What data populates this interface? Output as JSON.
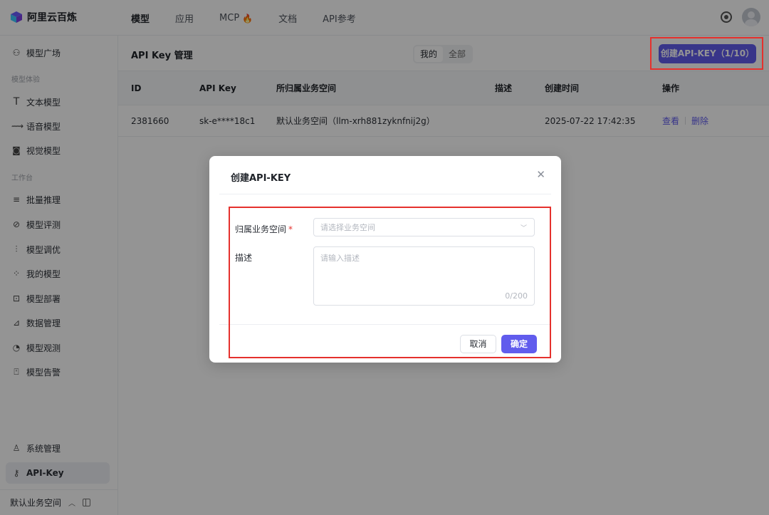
{
  "app": {
    "title": "阿里云百炼"
  },
  "topnav": {
    "items": [
      {
        "label": "模型",
        "active": true
      },
      {
        "label": "应用"
      },
      {
        "label": "MCP",
        "badge_icon": "flame-icon"
      },
      {
        "label": "文档"
      },
      {
        "label": "API参考"
      }
    ]
  },
  "sidebar": {
    "top_item": {
      "label": "模型广场",
      "icon": "model-square-icon"
    },
    "group_experience": "模型体验",
    "experience_items": [
      {
        "label": "文本模型",
        "icon": "text-icon"
      },
      {
        "label": "语音模型",
        "icon": "voice-icon"
      },
      {
        "label": "视觉模型",
        "icon": "camera-icon"
      }
    ],
    "group_workbench": "工作台",
    "workbench_items": [
      {
        "label": "批量推理",
        "icon": "batch-icon"
      },
      {
        "label": "模型评测",
        "icon": "evaluate-icon"
      },
      {
        "label": "模型调优",
        "icon": "tune-icon"
      },
      {
        "label": "我的模型",
        "icon": "grid-icon"
      },
      {
        "label": "模型部署",
        "icon": "deploy-icon"
      },
      {
        "label": "数据管理",
        "icon": "chart-icon"
      },
      {
        "label": "模型观测",
        "icon": "pie-icon"
      },
      {
        "label": "模型告警",
        "icon": "alert-icon"
      }
    ],
    "bottom_items": [
      {
        "label": "系统管理",
        "icon": "user-icon"
      },
      {
        "label": "API-Key",
        "icon": "key-icon",
        "active": true
      }
    ],
    "workspace": "默认业务空间"
  },
  "page": {
    "title": "API Key 管理",
    "filter": {
      "options": [
        "我的",
        "全部"
      ],
      "selected": "我的"
    },
    "create_button": "创建API-KEY（1/10）"
  },
  "table": {
    "headers": [
      "ID",
      "API Key",
      "所归属业务空间",
      "描述",
      "创建时间",
      "操作"
    ],
    "rows": [
      {
        "id": "2381660",
        "key": "sk-e****18c1",
        "workspace": "默认业务空间（llm-xrh881zyknfnij2g）",
        "desc": "",
        "created": "2025-07-22 17:42:35",
        "actions": [
          "查看",
          "删除"
        ]
      }
    ]
  },
  "modal": {
    "title": "创建API-KEY",
    "workspace_label": "归属业务空间",
    "required_mark": "*",
    "workspace_placeholder": "请选择业务空间",
    "desc_label": "描述",
    "desc_placeholder": "请输入描述",
    "desc_counter": "0/200",
    "cancel": "取消",
    "confirm": "确定"
  },
  "colors": {
    "accent": "#615ced",
    "highlight": "#e5312d"
  }
}
